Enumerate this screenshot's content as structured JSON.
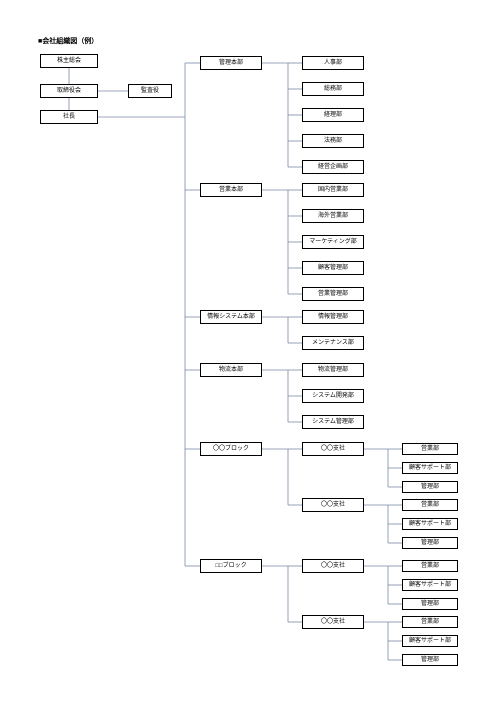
{
  "title": "■会社組織図（例）",
  "chart_data": {
    "type": "org-chart",
    "nodes": {
      "col1": [
        "株主総会",
        "取締役会",
        "社長"
      ],
      "auditor": "監査役",
      "col2_hq": [
        "管理本部",
        "営業本部",
        "情報システム本部",
        "物流本部",
        "〇〇ブロック",
        "□□ブロック"
      ],
      "kanri_depts": [
        "人事部",
        "総務部",
        "経理部",
        "法務部",
        "経営企画部"
      ],
      "eigyo_depts": [
        "国内営業部",
        "海外営業部",
        "マーケティング部",
        "顧客管理部",
        "営業管理部"
      ],
      "joho_depts": [
        "情報管理部",
        "メンテナンス部"
      ],
      "butsuryu_depts": [
        "物流管理部",
        "システム開発部",
        "システム管理部"
      ],
      "block1_branches": [
        "〇〇支社",
        "〇〇支社"
      ],
      "block2_branches": [
        "〇〇支社",
        "〇〇支社"
      ],
      "branch_depts": [
        "営業部",
        "顧客サポート部",
        "管理部"
      ]
    }
  },
  "nodes": {
    "n1": "株主総会",
    "n2": "取締役会",
    "n3": "社長",
    "aud": "監査役",
    "hq1": "管理本部",
    "hq2": "営業本部",
    "hq3": "情報システム本部",
    "hq4": "物流本部",
    "hq5": "〇〇ブロック",
    "hq6": "□□ブロック",
    "d1_1": "人事部",
    "d1_2": "総務部",
    "d1_3": "経理部",
    "d1_4": "法務部",
    "d1_5": "経営企画部",
    "d2_1": "国内営業部",
    "d2_2": "海外営業部",
    "d2_3": "マーケティング部",
    "d2_4": "顧客管理部",
    "d2_5": "営業管理部",
    "d3_1": "情報管理部",
    "d3_2": "メンテナンス部",
    "d4_1": "物流管理部",
    "d4_2": "システム開発部",
    "d4_3": "システム管理部",
    "b1_1": "〇〇支社",
    "b1_2": "〇〇支社",
    "b2_1": "〇〇支社",
    "b2_2": "〇〇支社",
    "s1": "営業部",
    "s2": "顧客サポート部",
    "s3": "管理部"
  }
}
